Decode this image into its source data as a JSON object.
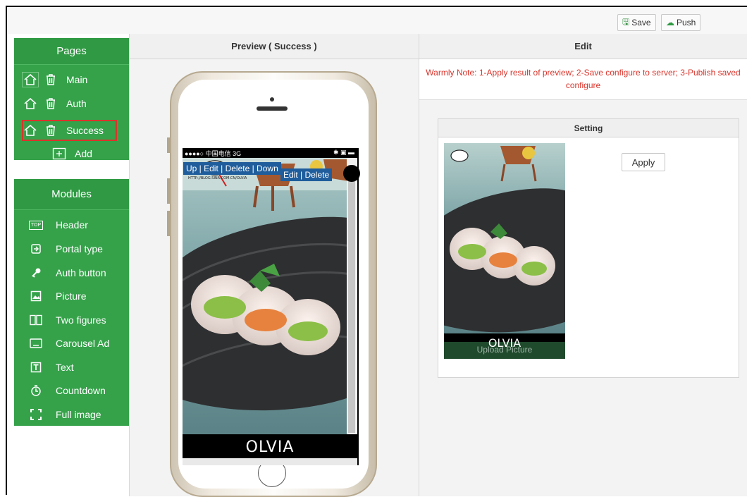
{
  "toolbar": {
    "save_label": "Save",
    "push_label": "Push"
  },
  "pages": {
    "title": "Pages",
    "items": [
      {
        "label": "Main"
      },
      {
        "label": "Auth"
      },
      {
        "label": "Success"
      }
    ],
    "add_label": "Add"
  },
  "modules": {
    "title": "Modules",
    "items": [
      {
        "label": "Header",
        "icon": "top-icon"
      },
      {
        "label": "Portal type",
        "icon": "portal-icon"
      },
      {
        "label": "Auth button",
        "icon": "key-icon"
      },
      {
        "label": "Picture",
        "icon": "picture-icon"
      },
      {
        "label": "Two figures",
        "icon": "two-figures-icon"
      },
      {
        "label": "Carousel Ad",
        "icon": "carousel-icon"
      },
      {
        "label": "Text",
        "icon": "text-icon"
      },
      {
        "label": "Countdown",
        "icon": "countdown-icon"
      },
      {
        "label": "Full image",
        "icon": "fullscreen-icon"
      }
    ]
  },
  "preview": {
    "title": "Preview ( Success )",
    "status_left": "●●●●○ 中国电信  3G",
    "status_right": "✱ ▣ ▬",
    "edit_bar_1": "Up | Edit | Delete | Down",
    "edit_bar_2": "Edit | Delete",
    "brand": "OLVIA",
    "watermark": "HTTP://BLOG.SINA.COM.CN/OLVIA"
  },
  "edit": {
    "title": "Edit",
    "note": "Warmly Note: 1-Apply result of preview; 2-Save configure to server; 3-Publish saved configure",
    "setting_title": "Setting",
    "apply_label": "Apply",
    "thumb_brand": "OLVIA",
    "thumb_upload": "Upload Picture"
  },
  "colors": {
    "green": "#35a24a",
    "accent_red": "#d9342b",
    "edit_blue": "#1f5d9c"
  }
}
